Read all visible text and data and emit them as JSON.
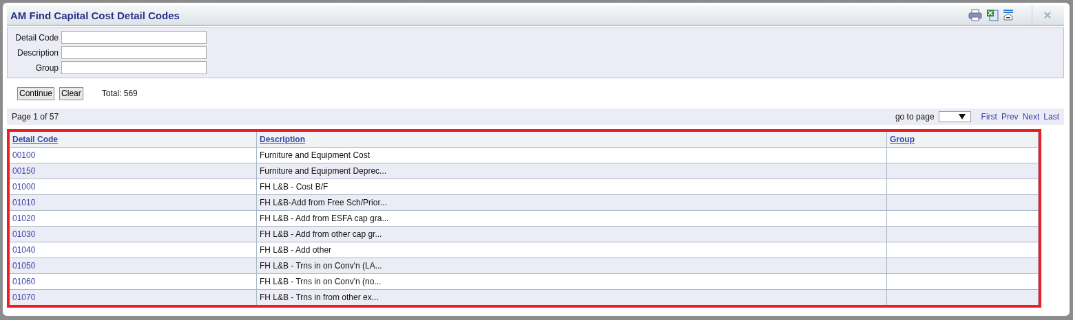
{
  "window": {
    "title": "AM Find Capital Cost Detail Codes"
  },
  "filters": [
    {
      "label": "Detail Code"
    },
    {
      "label": "Description"
    },
    {
      "label": "Group"
    }
  ],
  "buttons": [
    "Continue",
    "Clear"
  ],
  "total": "Total: 569",
  "pager": {
    "page_info": "Page 1 of 57",
    "go_to_label": "go to page",
    "links": [
      "First",
      "Prev",
      "Next",
      "Last"
    ]
  },
  "table": {
    "highlighted": true,
    "columns": [
      "Detail Code",
      "Description",
      "Group"
    ],
    "rows": [
      {
        "code": "00100",
        "description": "Furniture and Equipment Cost"
      },
      {
        "code": "00150",
        "description": "Furniture and Equipment Deprec..."
      },
      {
        "code": "01000",
        "description": "FH L&B - Cost B/F"
      },
      {
        "code": "01010",
        "description": "FH L&B-Add from Free Sch/Prior..."
      },
      {
        "code": "01020",
        "description": "FH L&B - Add from ESFA cap gra..."
      },
      {
        "code": "01030",
        "description": "FH L&B - Add from other cap gr..."
      },
      {
        "code": "01040",
        "description": "FH L&B - Add other"
      },
      {
        "code": "01050",
        "description": "FH L&B - Trns in on Conv'n (LA..."
      },
      {
        "code": "01060",
        "description": "FH L&B - Trns in on Conv'n (no..."
      },
      {
        "code": "01070",
        "description": "FH L&B - Trns in from other ex..."
      }
    ]
  }
}
